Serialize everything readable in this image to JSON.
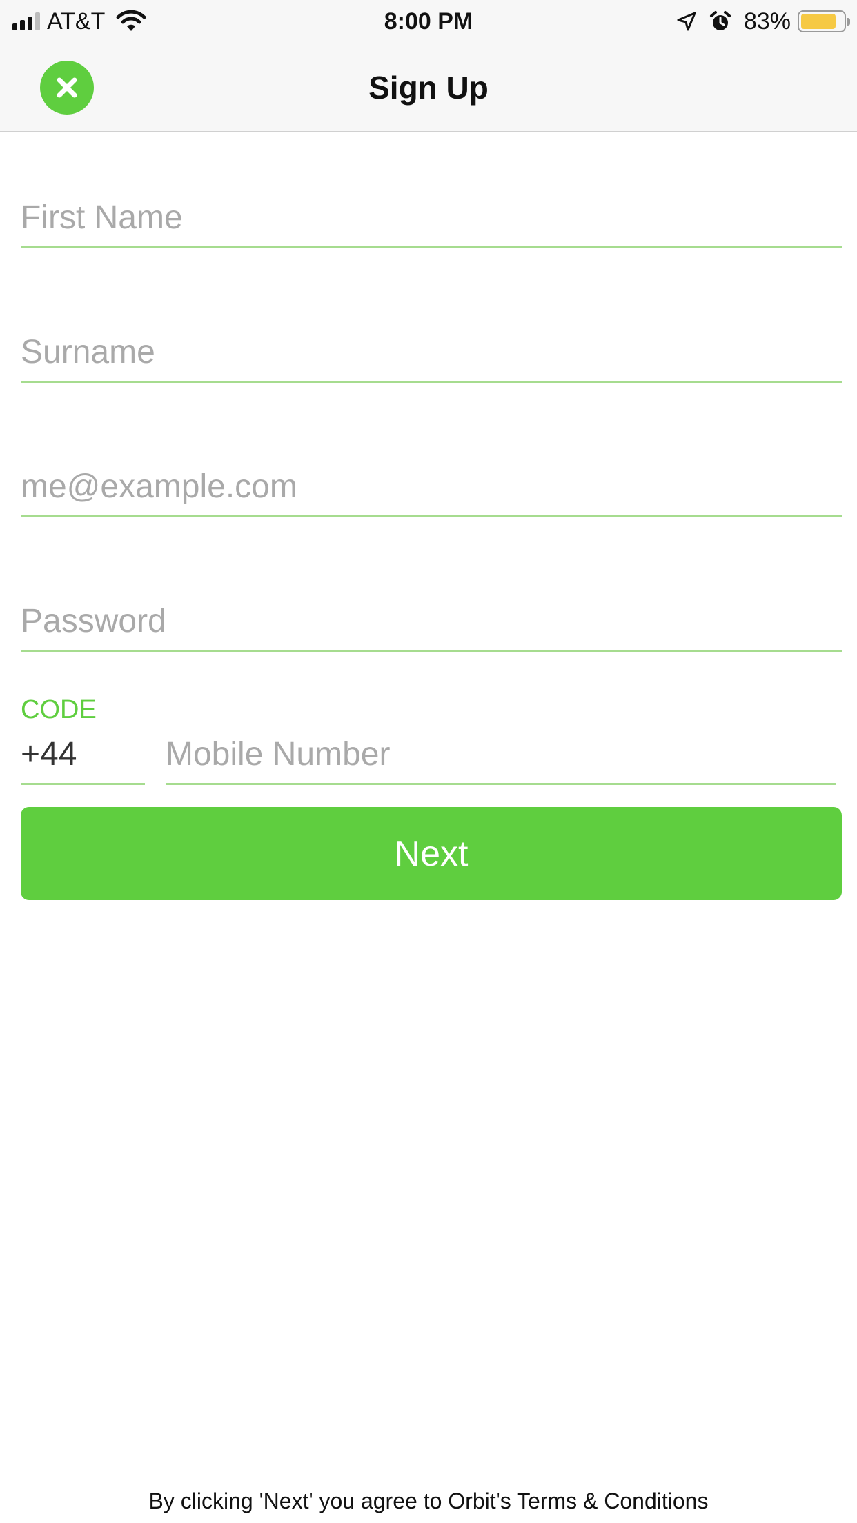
{
  "status_bar": {
    "carrier": "AT&T",
    "time": "8:00 PM",
    "battery_percent": "83%",
    "battery_level": 0.83,
    "battery_color": "#f6c944",
    "icons": [
      "signal-icon",
      "wifi-icon",
      "location-arrow-icon",
      "alarm-clock-icon",
      "battery-icon"
    ]
  },
  "nav": {
    "title": "Sign Up",
    "close_icon": "close-icon"
  },
  "form": {
    "first_name_placeholder": "First Name",
    "surname_placeholder": "Surname",
    "email_placeholder": "me@example.com",
    "password_placeholder": "Password",
    "code_label": "CODE",
    "code_value": "+44",
    "mobile_placeholder": "Mobile Number",
    "next_label": "Next"
  },
  "footer": {
    "terms_prefix": "By clicking 'Next' you agree to Orbit's ",
    "terms_link": "Terms & Conditions"
  },
  "colors": {
    "accent": "#5fce3f",
    "field_underline": "#a6dc8f",
    "placeholder": "#a9a9a9",
    "bar_background": "#f7f7f7"
  }
}
